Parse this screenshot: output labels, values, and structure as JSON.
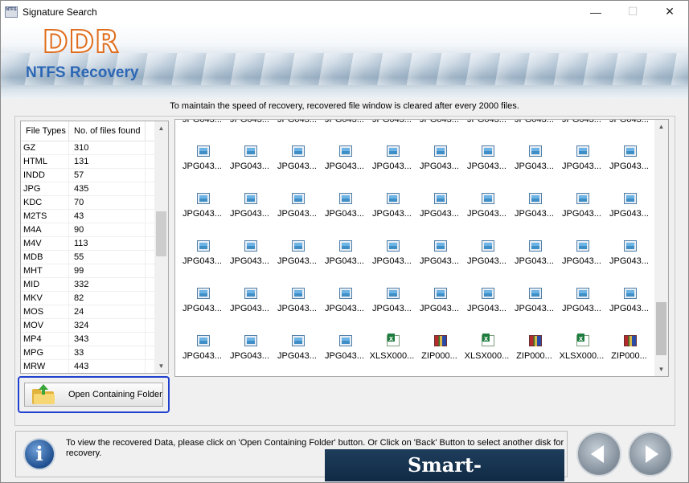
{
  "window": {
    "app_icon_text": "NTFS",
    "title": "Signature Search",
    "controls": {
      "minimize": "—",
      "maximize": "☐",
      "close": "✕"
    }
  },
  "header": {
    "brand": "DDR",
    "product": "NTFS Recovery"
  },
  "notice": "To maintain the speed of recovery, recovered file window is cleared after every 2000 files.",
  "file_types": {
    "columns": [
      "File Types",
      "No. of files found"
    ],
    "rows": [
      [
        "GZ",
        "310"
      ],
      [
        "HTML",
        "131"
      ],
      [
        "INDD",
        "57"
      ],
      [
        "JPG",
        "435"
      ],
      [
        "KDC",
        "70"
      ],
      [
        "M2TS",
        "43"
      ],
      [
        "M4A",
        "90"
      ],
      [
        "M4V",
        "113"
      ],
      [
        "MDB",
        "55"
      ],
      [
        "MHT",
        "99"
      ],
      [
        "MID",
        "332"
      ],
      [
        "MKV",
        "82"
      ],
      [
        "MOS",
        "24"
      ],
      [
        "MOV",
        "324"
      ],
      [
        "MP4",
        "343"
      ],
      [
        "MPG",
        "33"
      ],
      [
        "MRW",
        "443"
      ]
    ],
    "scroll_position": 0.42
  },
  "open_button": {
    "label": "Open Containing Folder"
  },
  "files": {
    "cut_label": "JPG043...",
    "rows": [
      [
        "JPG043...",
        "JPG043...",
        "JPG043...",
        "JPG043...",
        "JPG043...",
        "JPG043...",
        "JPG043...",
        "JPG043...",
        "JPG043...",
        "JPG043..."
      ],
      [
        "JPG043...",
        "JPG043...",
        "JPG043...",
        "JPG043...",
        "JPG043...",
        "JPG043...",
        "JPG043...",
        "JPG043...",
        "JPG043...",
        "JPG043..."
      ],
      [
        "JPG043...",
        "JPG043...",
        "JPG043...",
        "JPG043...",
        "JPG043...",
        "JPG043...",
        "JPG043...",
        "JPG043...",
        "JPG043...",
        "JPG043..."
      ],
      [
        "JPG043...",
        "JPG043...",
        "JPG043...",
        "JPG043...",
        "JPG043...",
        "JPG043...",
        "JPG043...",
        "JPG043...",
        "JPG043...",
        "JPG043..."
      ],
      [
        "JPG043...",
        "JPG043...",
        "JPG043...",
        "JPG043...",
        "XLSX000...",
        "ZIP000...",
        "XLSX000...",
        "ZIP000...",
        "XLSX000...",
        "ZIP000..."
      ]
    ],
    "scroll_position": 0.95
  },
  "status": {
    "info_icon": "i",
    "text": "To view the recovered Data, please click on 'Open Containing Folder' button. Or Click on 'Back' Button to select another disk for recovery."
  },
  "watermark": "Smart-Accountant.com",
  "nav": {
    "back_icon": "back-arrow-icon",
    "next_icon": "next-arrow-icon"
  }
}
